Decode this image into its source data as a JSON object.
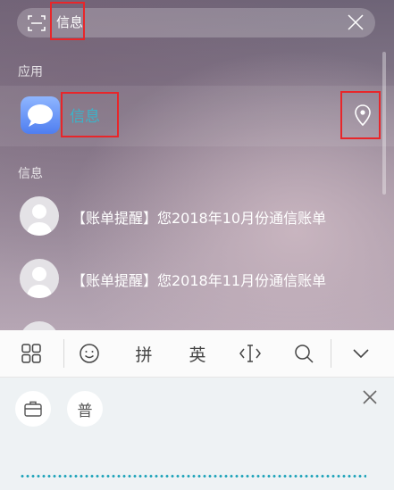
{
  "search": {
    "query": "信息"
  },
  "sections": {
    "apps": "应用",
    "messages": "信息"
  },
  "app_result": {
    "name": "信息"
  },
  "messages": [
    {
      "text": "【账单提醒】您2018年10月份通信账单"
    },
    {
      "text": "【账单提醒】您2018年11月份通信账单"
    }
  ],
  "keyboard": {
    "pinyin": "拼",
    "english": "英",
    "panel_button": "普"
  },
  "colors": {
    "accent": "#3bb3c9",
    "highlight": "#e8262a"
  }
}
